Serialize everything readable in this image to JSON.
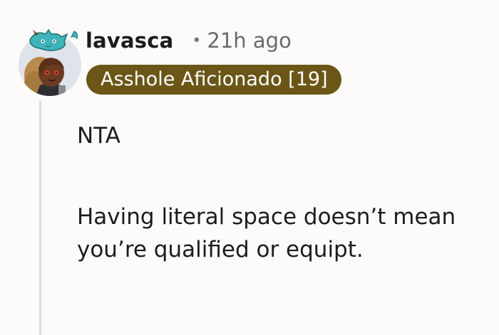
{
  "comment": {
    "author": "lavasca",
    "separator": "•",
    "timestamp": "21h ago",
    "flair": {
      "text": "Asshole Aficionado [19]",
      "background": "#6b5617",
      "text_color": "#ffffff"
    },
    "avatar": {
      "icon": "cartoon-avatar-icon",
      "description_colors": {
        "skin": "#6a3b22",
        "hair": "#b98a4d",
        "accessory": "#3fb5bb"
      }
    },
    "body": [
      "NTA",
      "Having literal space doesn’t mean you’re qualified or equipt."
    ]
  },
  "colors": {
    "background": "#fcfbfa",
    "thread_line": "#dcdcdc",
    "meta_text": "#6b6b6b"
  }
}
